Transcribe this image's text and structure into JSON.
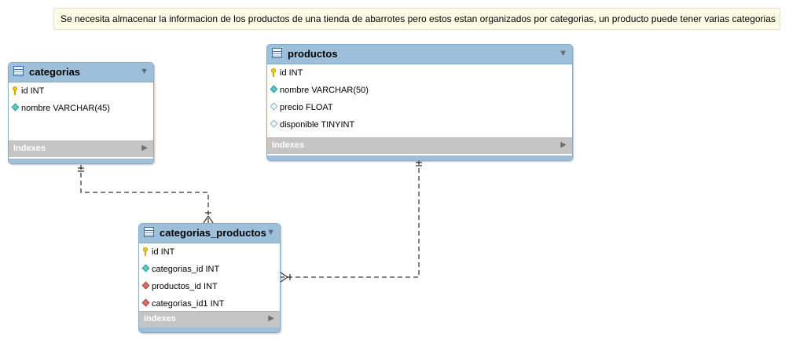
{
  "note": {
    "text": "Se necesita almacenar la informacion de los productos de una tienda de abarrotes pero estos estan organizados por categorias, un producto puede tener varias categorias"
  },
  "entities": {
    "categorias": {
      "title": "categorias",
      "columns": [
        {
          "label": "id INT",
          "icon": "primary-key-icon"
        },
        {
          "label": "nombre VARCHAR(45)",
          "icon": "not-null-column-icon"
        }
      ],
      "indexes_label": "Indexes"
    },
    "productos": {
      "title": "productos",
      "columns": [
        {
          "label": "id INT",
          "icon": "primary-key-icon"
        },
        {
          "label": "nombre VARCHAR(50)",
          "icon": "not-null-column-icon"
        },
        {
          "label": "precio FLOAT",
          "icon": "nullable-column-icon"
        },
        {
          "label": "disponible TINYINT",
          "icon": "nullable-column-icon"
        }
      ],
      "indexes_label": "Indexes"
    },
    "categorias_productos": {
      "title": "categorias_productos",
      "columns": [
        {
          "label": "id INT",
          "icon": "primary-key-icon"
        },
        {
          "label": "categorias_id INT",
          "icon": "not-null-column-icon"
        },
        {
          "label": "productos_id INT",
          "icon": "foreign-key-icon"
        },
        {
          "label": "categorias_id1 INT",
          "icon": "foreign-key-icon"
        }
      ],
      "indexes_label": "Indexes"
    }
  },
  "relationships": [
    {
      "from": "categorias",
      "to": "categorias_productos",
      "from_cardinality": "one-and-only-one",
      "to_cardinality": "one-or-many"
    },
    {
      "from": "productos",
      "to": "categorias_productos",
      "from_cardinality": "one-and-only-one",
      "to_cardinality": "one-or-many"
    }
  ],
  "colors": {
    "header": "#9ebfd9",
    "border": "#8aa9c2",
    "indexes_band": "#c5c5c5",
    "note_background": "#fefee8",
    "primary_key": "#f2c81b",
    "not_null": "#5ec8c8",
    "foreign_key": "#d9706a"
  }
}
